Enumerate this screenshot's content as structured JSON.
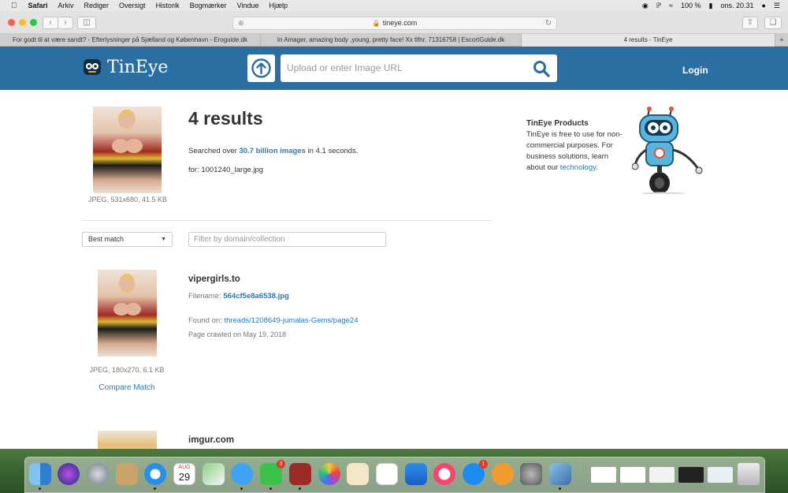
{
  "menubar": {
    "items": [
      "Safari",
      "Arkiv",
      "Rediger",
      "Oversigt",
      "Historik",
      "Bogmærker",
      "Vindue",
      "Hjælp"
    ],
    "battery": "100 %",
    "clock": "ons. 20.31"
  },
  "browser": {
    "url": "tineye.com",
    "tabs": [
      "For godt til at være sandt? - Efterlysninger på Sjælland og København - Eroguide.dk",
      "In Amager, amazing body ,young, pretty face! Xx tlfnr. 71316758 | EscortGuide.dk",
      "4 results - TinEye"
    ],
    "new_tab": "+"
  },
  "header": {
    "brand": "TinEye",
    "search_placeholder": "Upload or enter Image URL",
    "login": "Login"
  },
  "query": {
    "image_info": "JPEG, 531x680, 41.5 KB",
    "results_title": "4 results",
    "searched_prefix": "Searched over",
    "searched_count": "30.7 billion images",
    "searched_suffix": "in 4.1 seconds.",
    "for_line": "for: 1001240_large.jpg"
  },
  "products": {
    "title": "TinEye Products",
    "text": "TinEye is free to use for non-commercial purposes. For business solutions, learn about our",
    "link": "technology",
    "end": "."
  },
  "controls": {
    "sort": "Best match",
    "filter_placeholder": "Filter by domain/collection"
  },
  "results": [
    {
      "domain": "vipergirls.to",
      "filename_label": "Filename:",
      "filename": "564cf5e8a6538.jpg",
      "found_label": "Found on:",
      "found_on": "threads/1208649-jumalas-Gems/page24",
      "crawled": "Page crawled on May 19, 2018",
      "image_info": "JPEG, 180x270, 6.1 KB",
      "compare": "Compare Match"
    },
    {
      "domain": "imgur.com"
    }
  ],
  "dock": {
    "calendar_month": "AUG",
    "calendar_day": "29",
    "facetime_badge": "3",
    "appstore_badge": "1"
  },
  "colors": {
    "header_blue": "#2b6ea1",
    "link_blue": "#2b79b3"
  }
}
